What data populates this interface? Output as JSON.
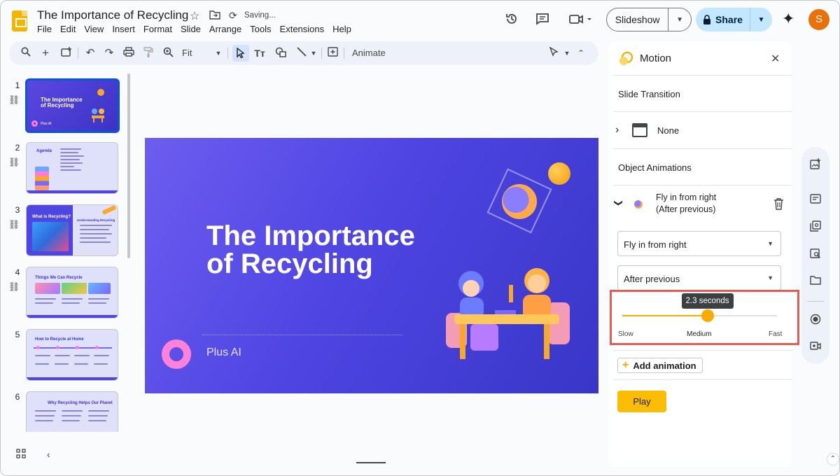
{
  "header": {
    "doc_title": "The Importance of Recycling",
    "saving_status": "Saving...",
    "menu": [
      "File",
      "Edit",
      "View",
      "Insert",
      "Format",
      "Slide",
      "Arrange",
      "Tools",
      "Extensions",
      "Help"
    ],
    "slideshow_label": "Slideshow",
    "share_label": "Share",
    "avatar_letter": "S"
  },
  "toolbar": {
    "zoom_label": "Fit",
    "animate_label": "Animate"
  },
  "filmstrip": {
    "slides": [
      {
        "number": "1",
        "title": "The Importance of Recycling",
        "subtitle": "Plus AI"
      },
      {
        "number": "2",
        "title": "Agenda"
      },
      {
        "number": "3",
        "title": "What is Recycling?",
        "side_title": "Understanding Recycling"
      },
      {
        "number": "4",
        "title": "Things We Can Recycle"
      },
      {
        "number": "5",
        "title": "How to Recycle at Home"
      },
      {
        "number": "6",
        "title": "Why Recycling Helps Our Planet"
      }
    ]
  },
  "slide": {
    "title": "The Importance of Recycling",
    "subtitle": "Plus AI"
  },
  "motion_panel": {
    "title": "Motion",
    "slide_transition_label": "Slide Transition",
    "transition_value": "None",
    "object_animations_label": "Object Animations",
    "animation_name": "Fly in from right",
    "animation_timing": "(After previous)",
    "effect_dropdown": "Fly in from right",
    "start_dropdown": "After previous",
    "speed_tooltip": "2.3 seconds",
    "speed_value": 0.55,
    "speed_labels": {
      "slow": "Slow",
      "medium": "Medium",
      "fast": "Fast"
    },
    "add_animation_label": "Add animation",
    "play_label": "Play"
  },
  "colors": {
    "accent_blue": "#0b57d0",
    "share_bg": "#c2e7ff",
    "slider_orange": "#f9ab00",
    "play_yellow": "#fbbc04",
    "highlight_red": "#e35d55",
    "slide_purple": "#4f45e3"
  },
  "icons": [
    "slides-logo",
    "star-icon",
    "move-to-folder-icon",
    "sync-icon",
    "history-icon",
    "comment-icon",
    "video-call-icon",
    "lock-icon",
    "gemini-sparkle-icon",
    "search-icon",
    "add-icon",
    "new-slide-icon",
    "undo-icon",
    "redo-icon",
    "print-icon",
    "paint-format-icon",
    "zoom-icon",
    "select-cursor-icon",
    "text-box-icon",
    "shape-icon",
    "line-icon",
    "insert-comment-icon",
    "pen-icon",
    "chevron-up-icon",
    "motion-icon",
    "close-icon",
    "link-icon",
    "trash-icon",
    "grid-view-icon",
    "chevron-left-icon"
  ]
}
